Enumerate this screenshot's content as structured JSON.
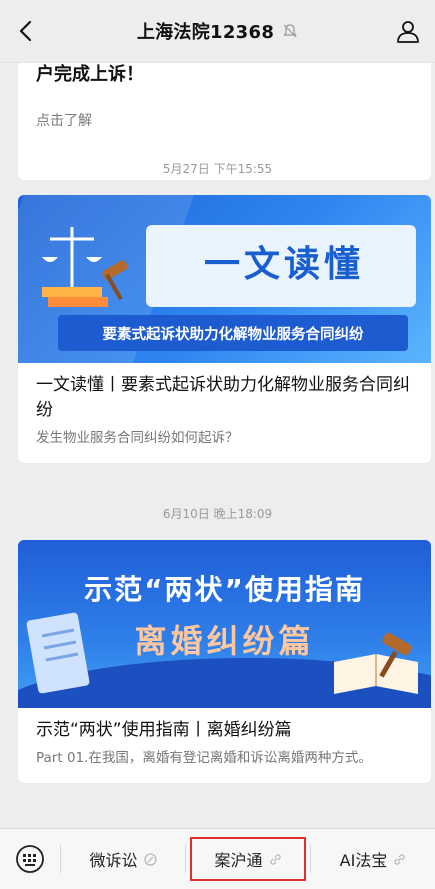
{
  "header": {
    "title": "上海法院12368"
  },
  "feed": {
    "partial_card": {
      "title": "户完成上诉！",
      "desc": "点击了解"
    },
    "articles": [
      {
        "time": "5月27日 下午15:55",
        "banner_headline": "一文读懂",
        "banner_sub": "要素式起诉状助力化解物业服务合同纠纷",
        "title": "一文读懂丨要素式起诉状助力化解物业服务合同纠纷",
        "desc": "发生物业服务合同纠纷如何起诉？"
      },
      {
        "time": "6月10日 晚上18:09",
        "banner_headline": "示范“两状”使用指南",
        "banner_sub": "离婚纠纷篇",
        "title": "示范“两状”使用指南丨离婚纠纷篇",
        "desc": "Part 01.在我国，离婚有登记离婚和诉讼离婚两种方式。"
      }
    ]
  },
  "bottom_menu": {
    "items": [
      {
        "label": "微诉讼"
      },
      {
        "label": "案沪通"
      },
      {
        "label": "AI法宝"
      }
    ]
  },
  "colors": {
    "highlight": "#e02d2d",
    "banner_blue": "#1c63d6"
  }
}
